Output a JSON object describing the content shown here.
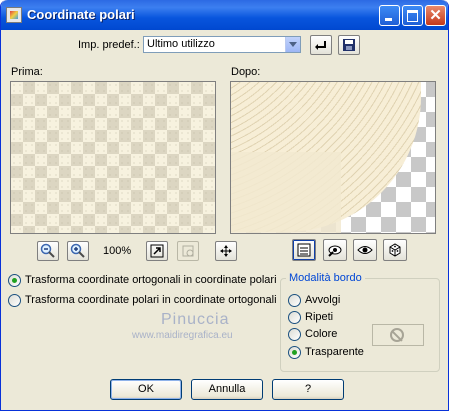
{
  "window": {
    "title": "Coordinate polari"
  },
  "preset": {
    "label": "Imp. predef.:",
    "selected": "Ultimo utilizzo"
  },
  "preview": {
    "before_label": "Prima:",
    "after_label": "Dopo:",
    "zoom": "100%"
  },
  "conversion": {
    "options": [
      {
        "label": "Trasforma coordinate ortogonali in coordinate polari",
        "selected": true
      },
      {
        "label": "Trasforma coordinate polari in coordinate ortogonali",
        "selected": false
      }
    ]
  },
  "edge_mode": {
    "title": "Modalità bordo",
    "options": [
      {
        "label": "Avvolgi",
        "selected": false
      },
      {
        "label": "Ripeti",
        "selected": false
      },
      {
        "label": "Colore",
        "selected": false
      },
      {
        "label": "Trasparente",
        "selected": true
      }
    ]
  },
  "watermark": {
    "name": "Pinuccia",
    "site": "www.maidiregrafica.eu"
  },
  "buttons": {
    "ok": "OK",
    "cancel": "Annulla",
    "help": "?"
  },
  "icons": {
    "zoom_out": "zoom-out-icon",
    "zoom_in": "zoom-in-icon",
    "fit": "fit-window-icon",
    "hand": "pan-icon",
    "move": "move-icon",
    "reset": "reset-icon",
    "save": "save-icon"
  }
}
